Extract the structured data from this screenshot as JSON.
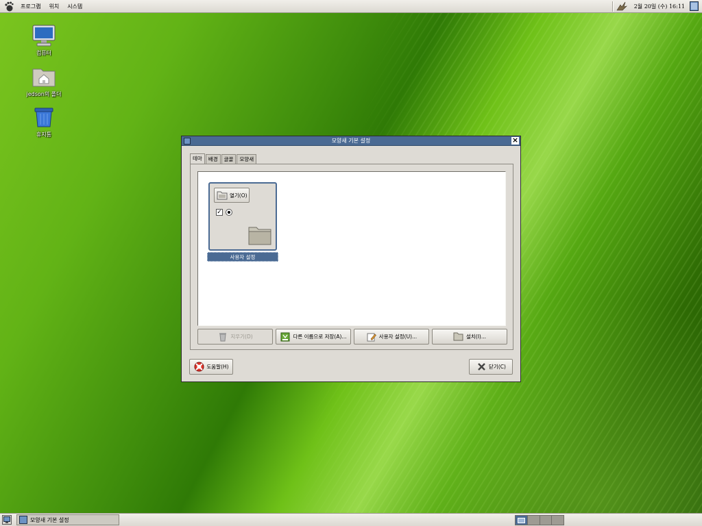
{
  "top_panel": {
    "menus": [
      "프로그램",
      "위치",
      "시스템"
    ],
    "clock": "2월 20일 (수) 16:11"
  },
  "desktop_icons": [
    {
      "label": "컴퓨터",
      "icon": "computer-icon"
    },
    {
      "label": "jedson의 폴더",
      "icon": "home-folder-icon"
    },
    {
      "label": "휴지통",
      "icon": "trash-icon"
    }
  ],
  "dialog": {
    "title": "모양새 기본 설정",
    "tabs": [
      "테마",
      "배경",
      "글꼴",
      "모양새"
    ],
    "active_tab": "테마",
    "theme_preview": {
      "button_label": "열기(O)",
      "checkbox_checked": true,
      "radio_selected": true
    },
    "theme_label": "사용자 설정",
    "buttons": {
      "delete": "지우기(D)",
      "save_as": "다른 이름으로 저장(A)...",
      "customize": "사용자 설정(U)...",
      "install": "설치(I)..."
    },
    "help": "도움말(H)",
    "close": "닫기(C)"
  },
  "bottom_panel": {
    "task": "모양새 기본 설정",
    "workspaces": 4,
    "active_workspace": 1
  },
  "colors": {
    "selection": "#4a6a93",
    "dialog_bg": "#dedbd5",
    "panel_bg": "#e6e3dc"
  }
}
